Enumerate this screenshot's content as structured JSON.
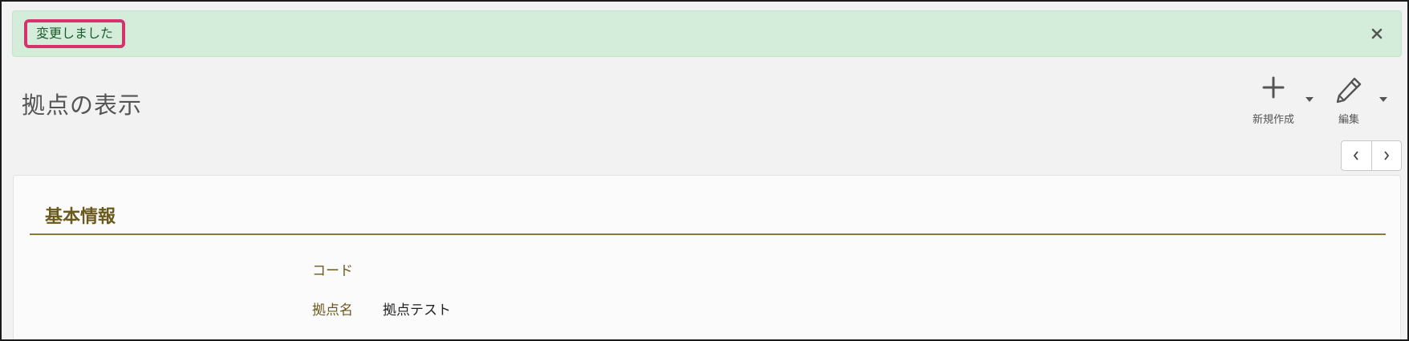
{
  "alert": {
    "message": "変更しました",
    "close_icon": "close-icon"
  },
  "header": {
    "title": "拠点の表示"
  },
  "toolbar": {
    "new_label": "新規作成",
    "new_icon": "plus-icon",
    "edit_label": "編集",
    "edit_icon": "pencil-icon",
    "dropdown_icon": "caret-down-icon"
  },
  "pager": {
    "prev_icon": "chevron-left-icon",
    "next_icon": "chevron-right-icon"
  },
  "section": {
    "title": "基本情報",
    "fields": [
      {
        "label": "コード",
        "value": ""
      },
      {
        "label": "拠点名",
        "value": "拠点テスト"
      }
    ]
  },
  "colors": {
    "alert_bg": "#d4eddb",
    "alert_highlight": "#d6336c",
    "section_accent": "#6b5a1e"
  }
}
